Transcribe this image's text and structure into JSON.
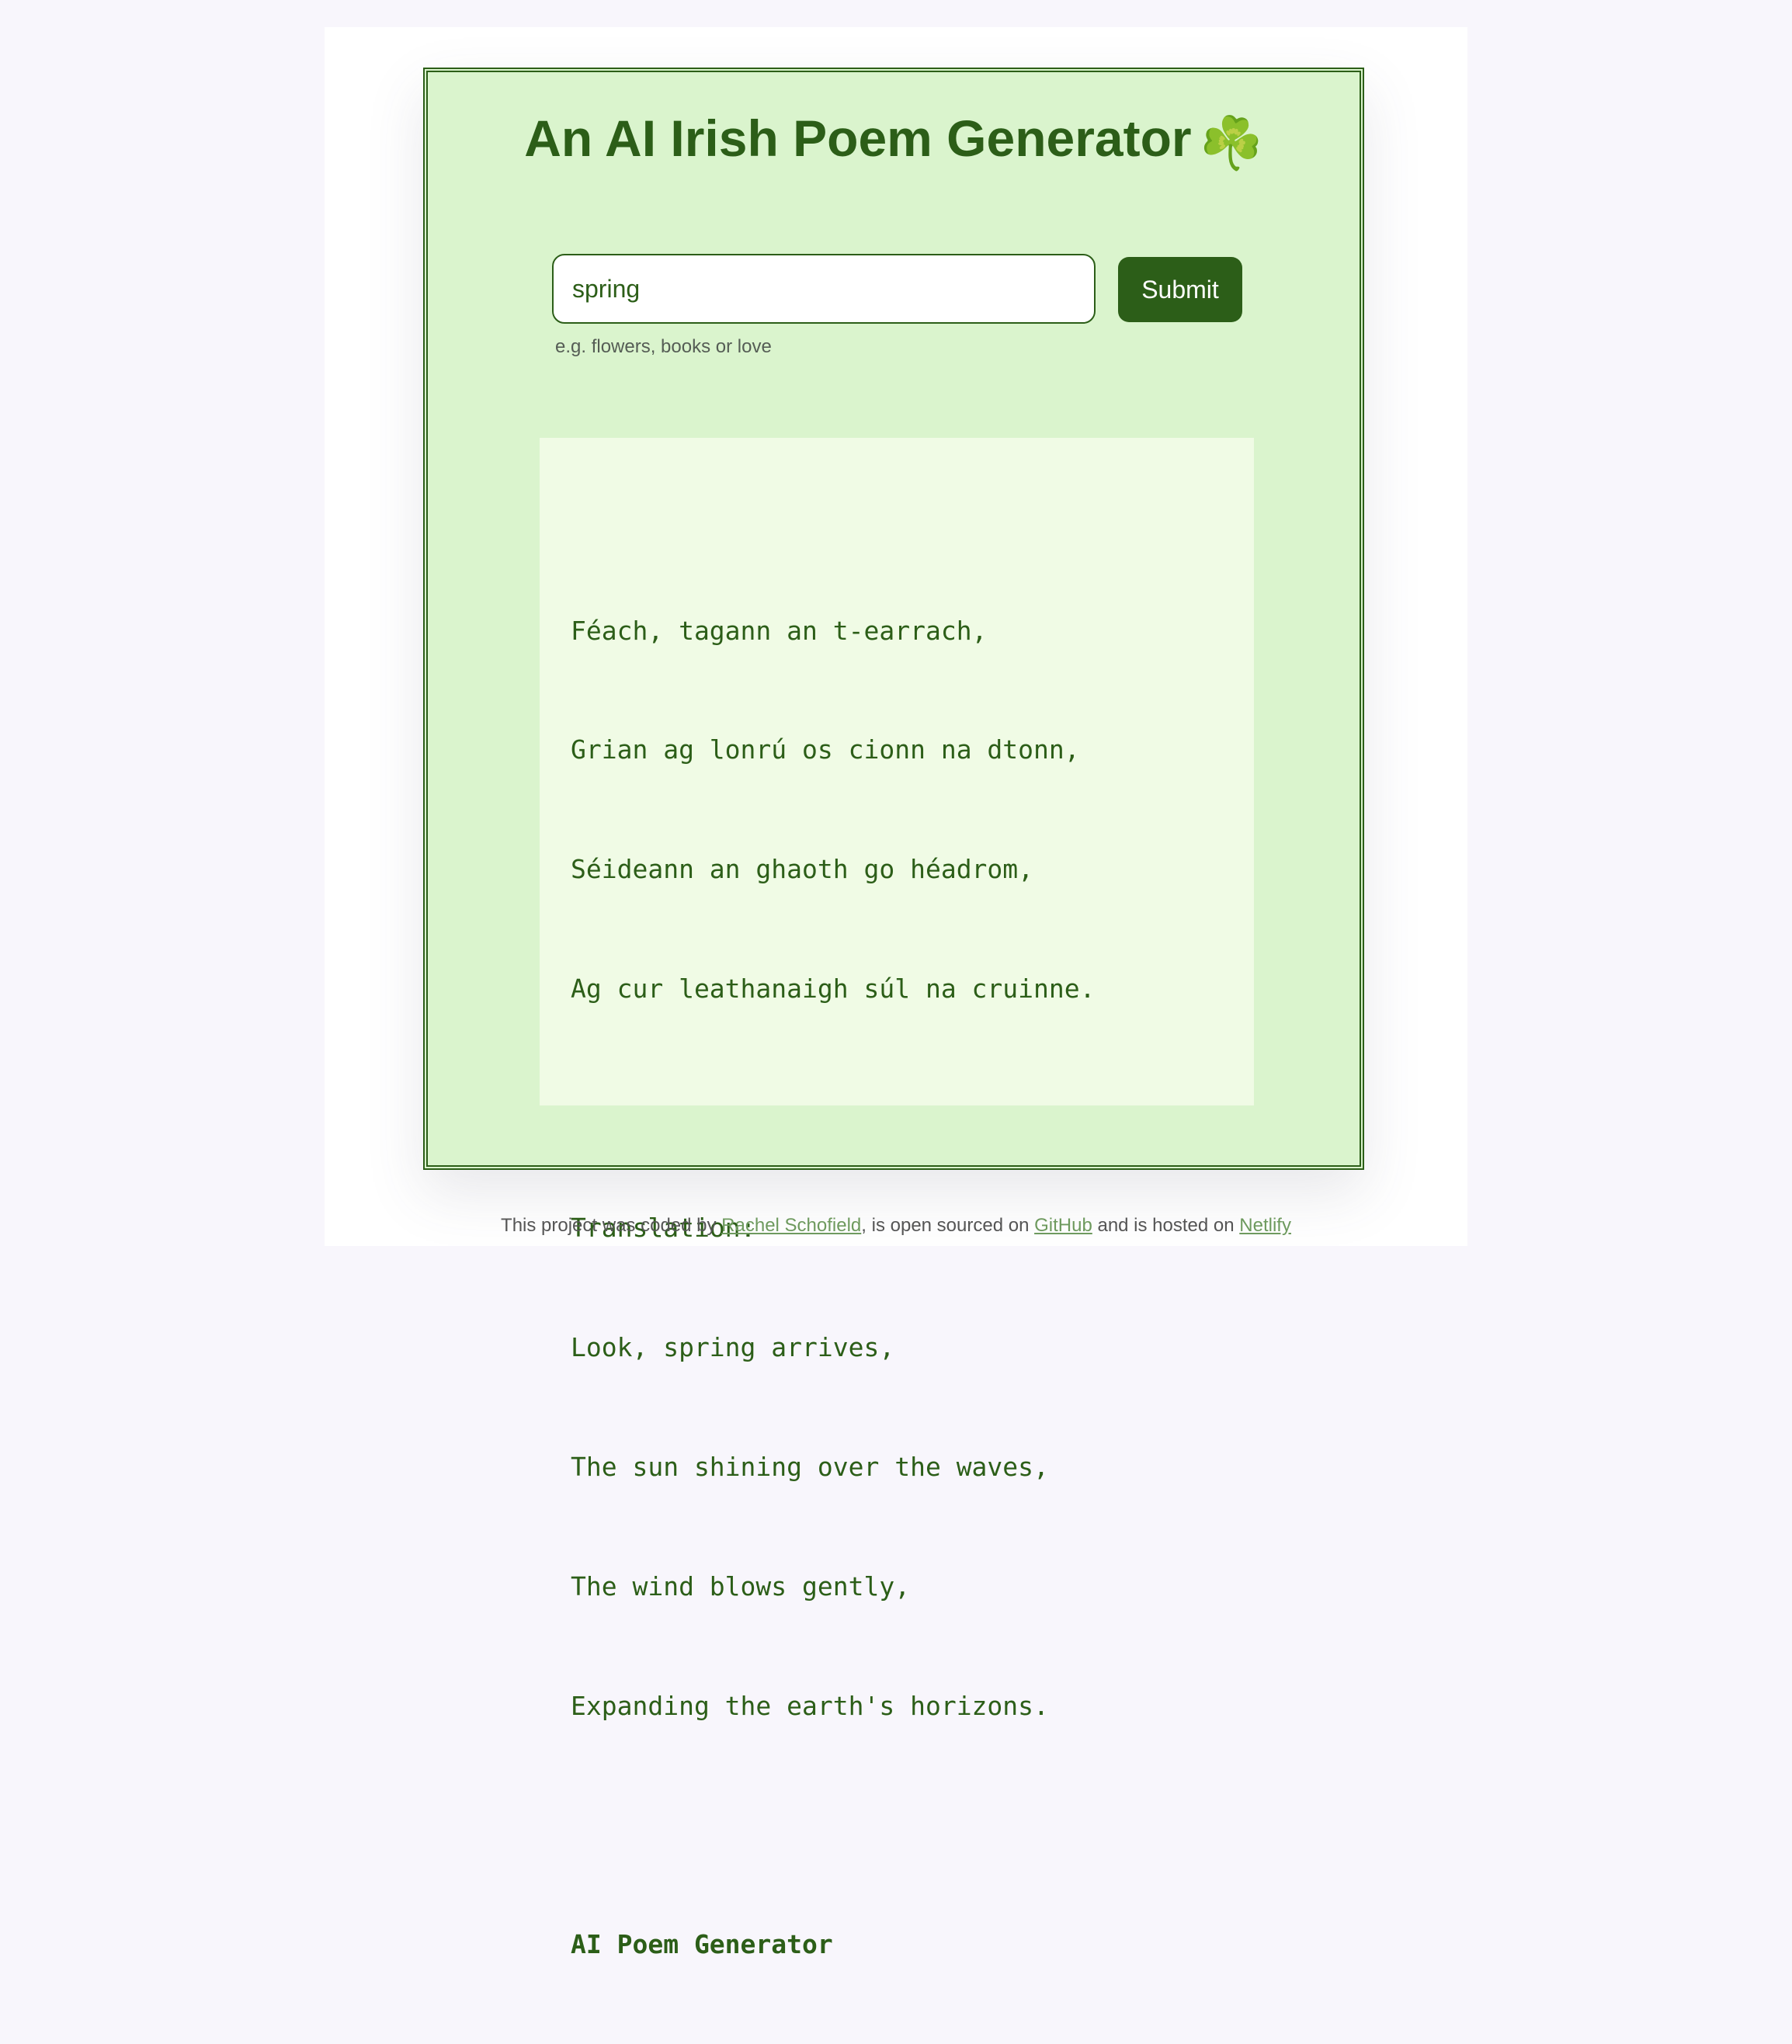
{
  "header": {
    "title": "An AI Irish Poem Generator",
    "emoji": "☘️"
  },
  "form": {
    "input_value": "spring",
    "hint": "e.g. flowers, books or love",
    "submit_label": "Submit"
  },
  "poem": {
    "irish_lines": [
      "Féach, tagann an t-earrach,",
      "Grian ag lonrú os cionn na dtonn,",
      "Séideann an ghaoth go héadrom,",
      "Ag cur leathanaigh súl na cruinne."
    ],
    "translation_label": "Translation:",
    "translation_lines": [
      "Look, spring arrives,",
      "The sun shining over the waves,",
      "The wind blows gently,",
      "Expanding the earth's horizons."
    ],
    "signature": "AI Poem Generator"
  },
  "footer": {
    "text_1": "This project was coded by ",
    "author_link": "Rachel Schofield",
    "text_2": ", is open sourced on ",
    "github_link": "GitHub",
    "text_3": " and is hosted on ",
    "netlify_link": "Netlify"
  },
  "colors": {
    "primary_green": "#2c5e18",
    "card_background": "#daf4cd",
    "poem_background": "#f0fbe5",
    "page_background": "#f8f6fc"
  }
}
